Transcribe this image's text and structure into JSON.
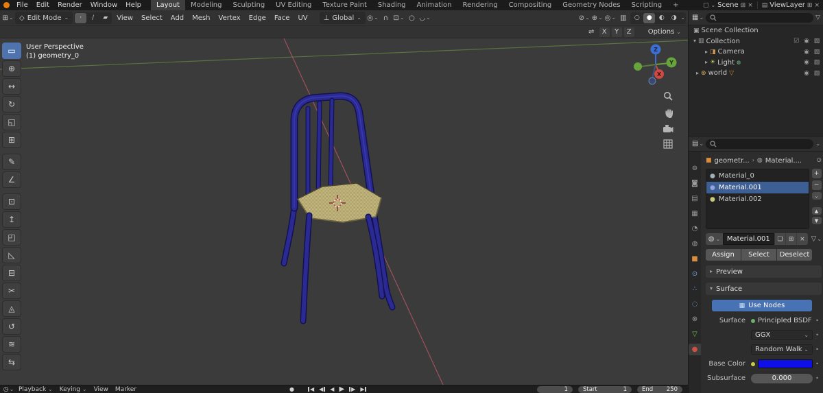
{
  "icons": {
    "chevron_down": "⌄",
    "breadcrumb_sep": "›",
    "arrow_right": "▸",
    "arrow_down": "▾",
    "plus": "+",
    "minus": "−",
    "close": "×",
    "eye": "◉",
    "render_toggle": "▨",
    "checkbox": "☑",
    "funnel": "▽",
    "pin": "⊙",
    "up": "▲",
    "down": "▼",
    "decorator": "•",
    "world_badge": "▽"
  },
  "topbar": {
    "menus": [
      "File",
      "Edit",
      "Render",
      "Window",
      "Help"
    ],
    "workspaces": [
      "Layout",
      "Modeling",
      "Sculpting",
      "UV Editing",
      "Texture Paint",
      "Shading",
      "Animation",
      "Rendering",
      "Compositing",
      "Geometry Nodes",
      "Scripting"
    ],
    "add_workspace": "+",
    "scene": "Scene",
    "viewlayer": "ViewLayer"
  },
  "header": {
    "mode": "Edit Mode",
    "menus": [
      "View",
      "Select",
      "Add",
      "Mesh",
      "Vertex",
      "Edge",
      "Face",
      "UV"
    ],
    "orientation": "Global",
    "mirror": {
      "x": "X",
      "y": "Y",
      "z": "Z"
    },
    "options": "Options"
  },
  "viewport": {
    "view_label": "User Perspective",
    "object_label": "(1) geometry_0",
    "axis_z": "Z",
    "axis_y": "Y",
    "axis_x": "X"
  },
  "outliner": {
    "root": "Scene Collection",
    "collection": "Collection",
    "camera": "Camera",
    "light": "Light",
    "world": "world"
  },
  "props": {
    "object_name": "geometr...",
    "material_crumb": "Material....",
    "slots": [
      "Material_0",
      "Material.001",
      "Material.002"
    ],
    "name": "Material.001",
    "assign": "Assign",
    "select": "Select",
    "deselect": "Deselect",
    "preview": "Preview",
    "surface": "Surface",
    "use_nodes": "Use Nodes",
    "surface_label": "Surface",
    "surface_value": "Principled BSDF",
    "distribution": "GGX",
    "subsurface_method": "Random Walk",
    "base_color_label": "Base Color",
    "base_color": "#0f0fe8",
    "subsurface_label": "Subsurface",
    "subsurface_value": "0.000",
    "accent_blue": "#4772b3"
  },
  "timeline": {
    "menus": [
      "Playback",
      "Keying",
      "View",
      "Marker"
    ],
    "frame": "1",
    "start_label": "Start",
    "start": "1",
    "end_label": "End",
    "end": "250"
  }
}
